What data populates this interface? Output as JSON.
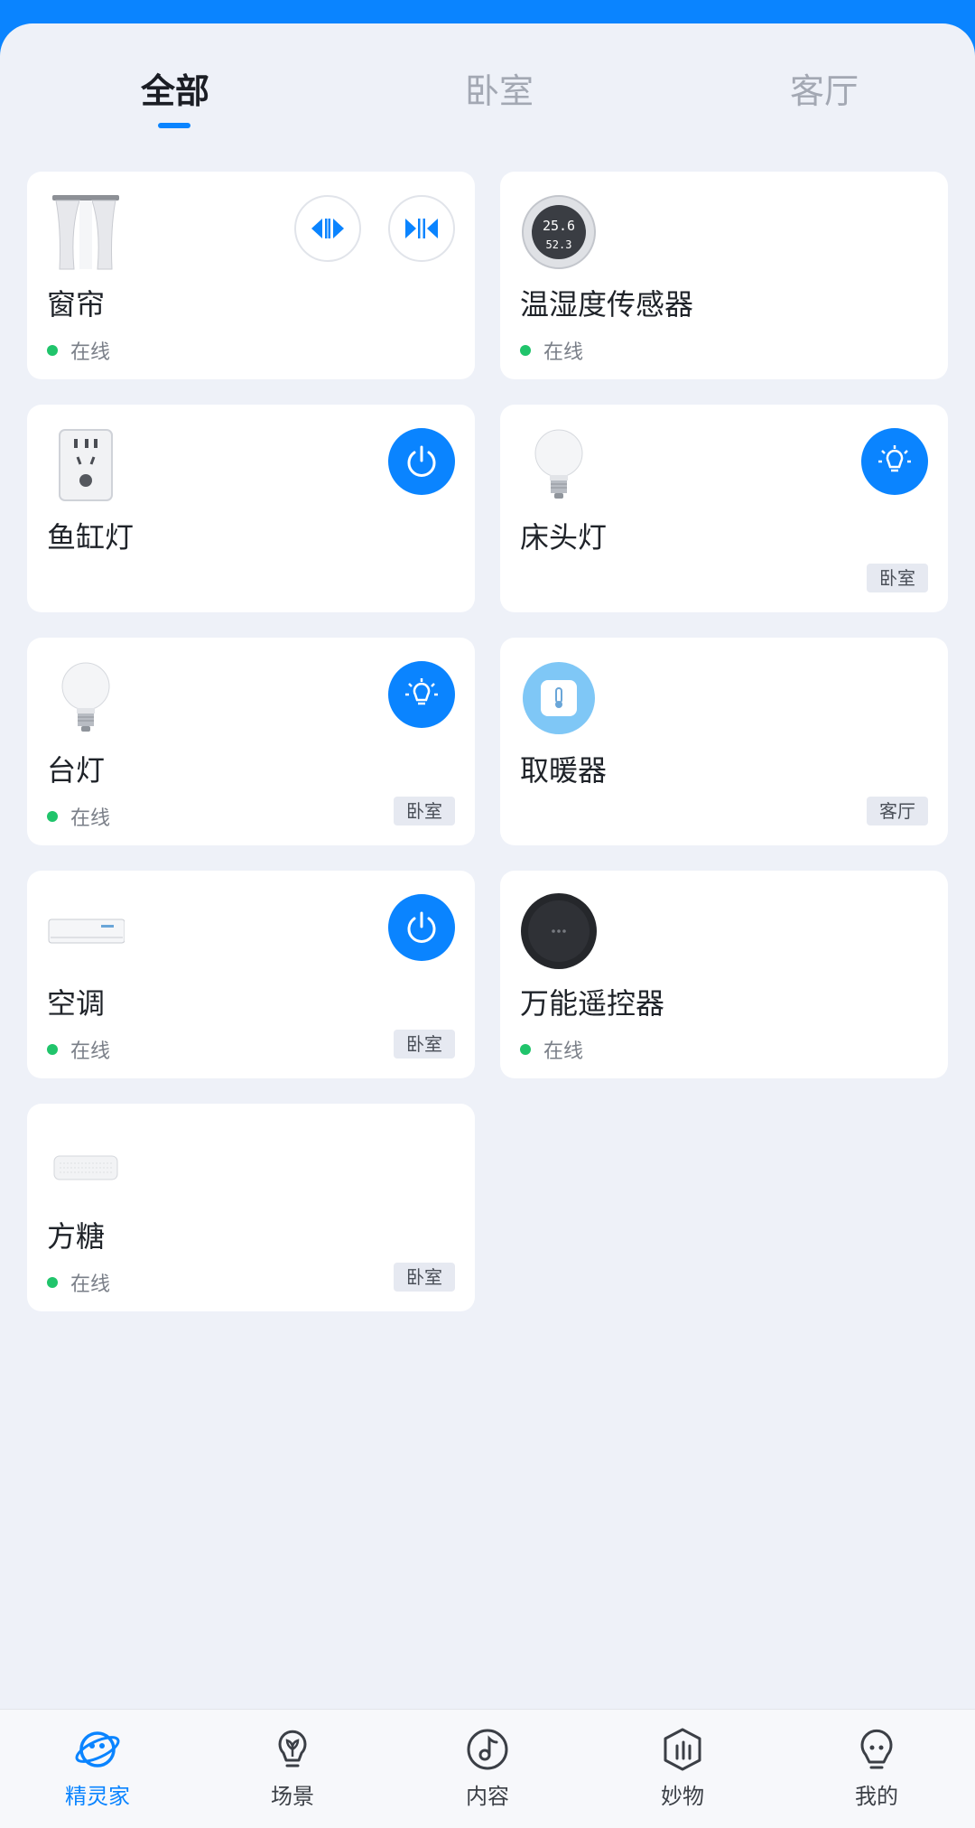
{
  "tabs": [
    {
      "label": "全部",
      "active": true
    },
    {
      "label": "卧室",
      "active": false
    },
    {
      "label": "客厅",
      "active": false
    }
  ],
  "devices": [
    {
      "name": "窗帘",
      "status": "在线",
      "icon": "curtain-icon",
      "controls": [
        "curtain-open-icon",
        "curtain-close-icon"
      ]
    },
    {
      "name": "温湿度传感器",
      "status": "在线",
      "icon": "thermo-hygrometer-icon",
      "display": {
        "temp": "25.6",
        "humidity": "52.3"
      }
    },
    {
      "name": "鱼缸灯",
      "status": "",
      "icon": "smart-plug-icon",
      "control": "power-icon"
    },
    {
      "name": "床头灯",
      "status": "",
      "room": "卧室",
      "icon": "bulb-icon",
      "control": "light-icon"
    },
    {
      "name": "台灯",
      "status": "在线",
      "room": "卧室",
      "icon": "bulb-icon",
      "control": "light-icon"
    },
    {
      "name": "取暖器",
      "status": "",
      "room": "客厅",
      "icon": "heater-icon"
    },
    {
      "name": "空调",
      "status": "在线",
      "room": "卧室",
      "icon": "air-conditioner-icon",
      "control": "power-icon"
    },
    {
      "name": "万能遥控器",
      "status": "在线",
      "icon": "ir-remote-hub-icon"
    },
    {
      "name": "方糖",
      "status": "在线",
      "room": "卧室",
      "icon": "speaker-box-icon"
    }
  ],
  "bottom_nav": [
    {
      "label": "精灵家",
      "icon": "planet-icon",
      "active": true
    },
    {
      "label": "场景",
      "icon": "scene-bulb-icon",
      "active": false
    },
    {
      "label": "内容",
      "icon": "music-note-icon",
      "active": false
    },
    {
      "label": "妙物",
      "icon": "shop-bag-icon",
      "active": false
    },
    {
      "label": "我的",
      "icon": "profile-icon",
      "active": false
    }
  ],
  "colors": {
    "accent": "#0a84ff",
    "online": "#20c46b",
    "background": "#eef1f8"
  }
}
